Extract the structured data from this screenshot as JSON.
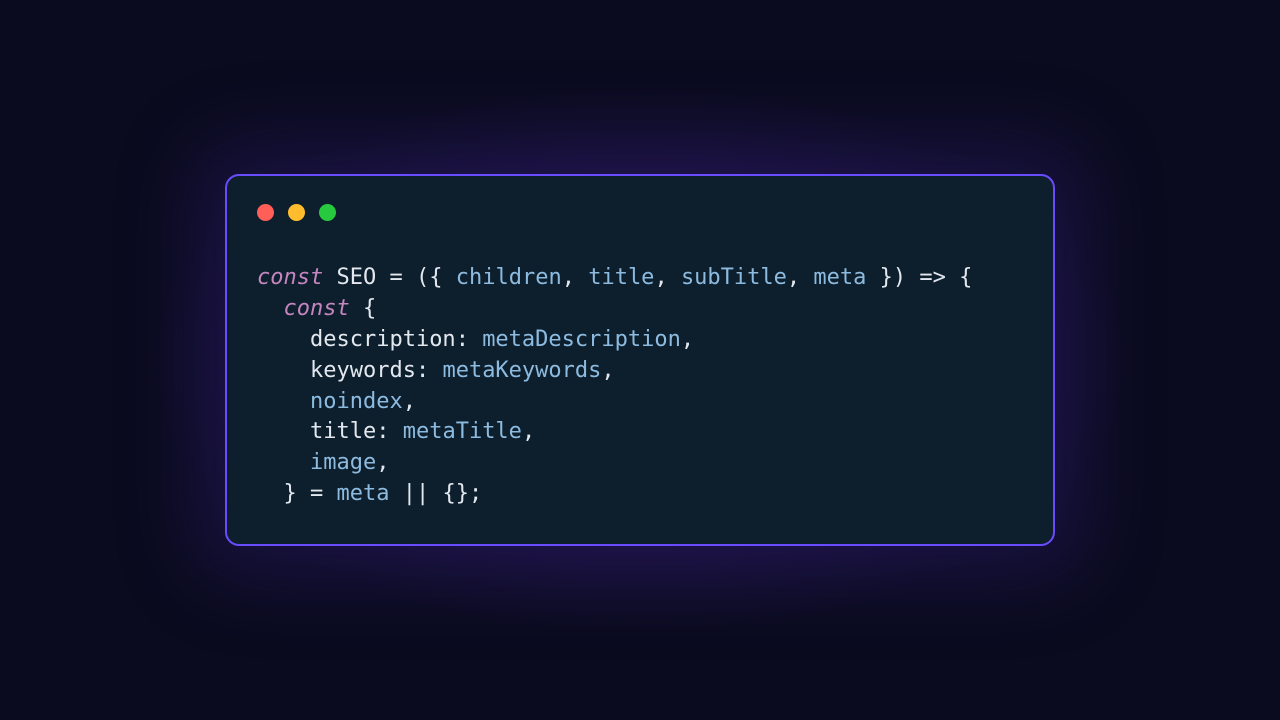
{
  "window": {
    "dot_red": "●",
    "dot_yellow": "●",
    "dot_green": "●"
  },
  "code": {
    "indent1": "  ",
    "indent2": "    ",
    "kw_const1": "const",
    "sp": " ",
    "fn_name": "SEO",
    "eq": " = ",
    "open_destruct": "({ ",
    "p_children": "children",
    "comma_sp": ", ",
    "p_title": "title",
    "p_subTitle": "subTitle",
    "p_meta": "meta",
    "close_destruct": " }) ",
    "arrow": "=>",
    "open_brace": " {",
    "kw_const2": "const",
    "open_brace2": " {",
    "k_description": "description",
    "colon_sp": ": ",
    "v_metaDescription": "metaDescription",
    "comma": ",",
    "k_keywords": "keywords",
    "v_metaKeywords": "metaKeywords",
    "k_noindex": "noindex",
    "k_title": "title",
    "v_metaTitle": "metaTitle",
    "k_image": "image",
    "close_brace2": "}",
    "eq2": " = ",
    "meta_ref": "meta",
    "or_op": " || ",
    "empty_obj": "{}",
    "semi": ";"
  }
}
